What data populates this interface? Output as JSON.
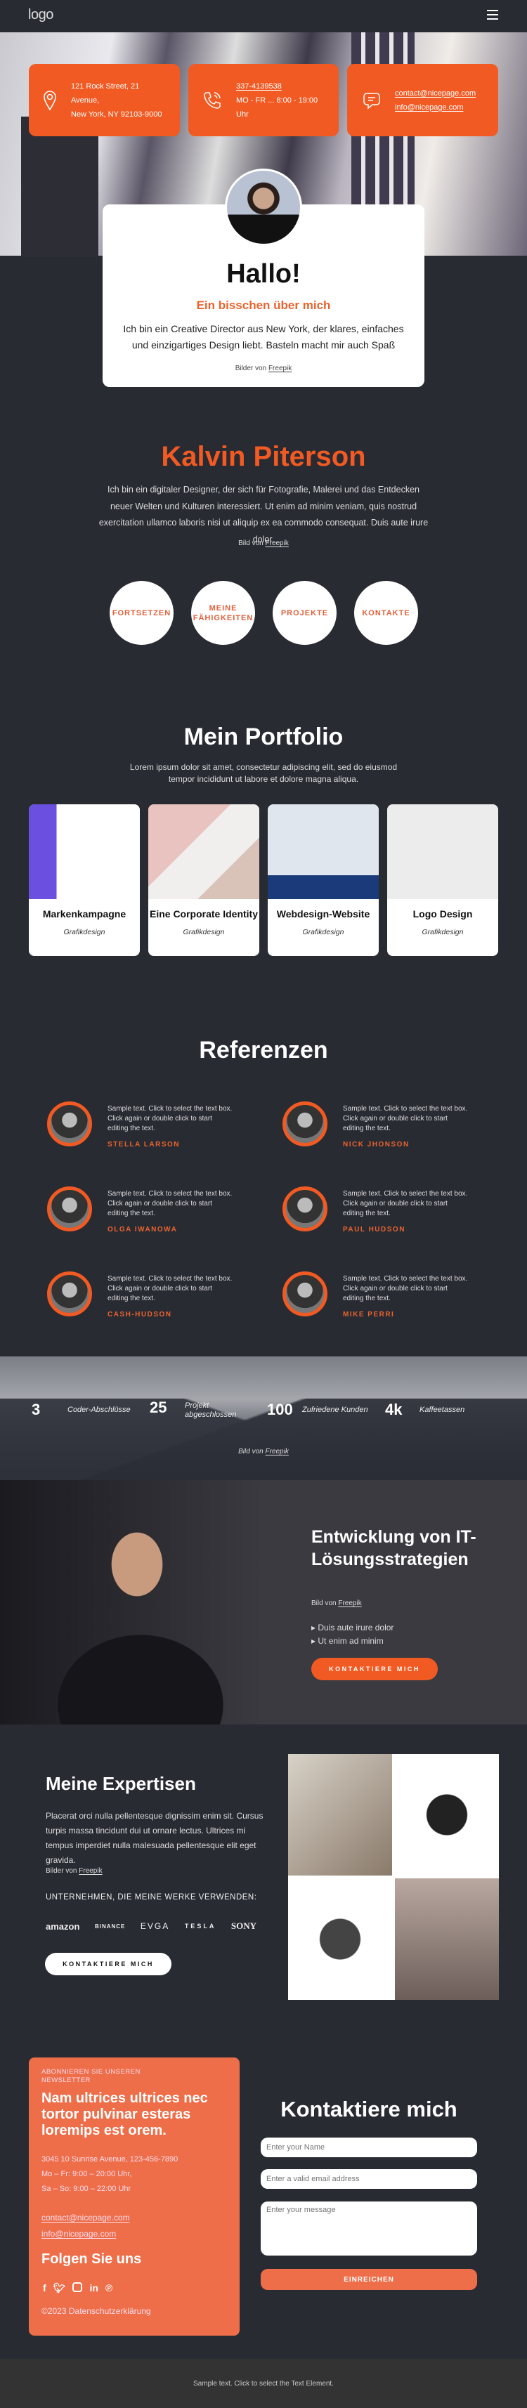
{
  "header": {
    "logo": "logo",
    "menu_icon": "hamburger-icon"
  },
  "colors": {
    "accent": "#f15a22",
    "newsletter": "#ee6e4a",
    "background": "#292b33",
    "footer": "#333333"
  },
  "info_cards": [
    {
      "icon": "map-pin-icon",
      "line1": "121 Rock Street, 21 Avenue,",
      "line2": "New York, NY 92103-9000"
    },
    {
      "icon": "phone-icon",
      "line1": "337-4139538",
      "line2": "MO - FR ... 8:00 - 19:00 Uhr"
    },
    {
      "icon": "chat-icon",
      "line1": "contact@nicepage.com",
      "line2": "info@nicepage.com"
    }
  ],
  "hello": {
    "title": "Hallo!",
    "subtitle": "Ein bisschen über mich",
    "text": "Ich bin ein Creative Director aus New York, der klares, einfaches und einzigartiges Design liebt. Basteln macht mir auch Spaß",
    "credit_prefix": "Bilder von",
    "credit_link": "Freepik"
  },
  "about": {
    "name": "Kalvin Piterson",
    "text": "Ich bin ein digitaler Designer, der sich für Fotografie, Malerei und das Entdecken neuer Welten und Kulturen interessiert. Ut enim ad minim veniam, quis nostrud exercitation ullamco laboris nisi ut aliquip ex ea commodo consequat. Duis aute irure dolor.",
    "credit_prefix": "Bild von",
    "credit_link": "Freepik",
    "buttons": [
      "FORTSETZEN",
      "MEINE FÄHIGKEITEN",
      "PROJEKTE",
      "KONTAKTE"
    ]
  },
  "portfolio": {
    "title": "Mein Portfolio",
    "text": "Lorem ipsum dolor sit amet, consectetur adipiscing elit, sed do eiusmod tempor incididunt ut labore et dolore magna aliqua.",
    "items": [
      {
        "title": "Markenkampagne",
        "category": "Grafikdesign"
      },
      {
        "title": "Eine Corporate Identity",
        "category": "Grafikdesign"
      },
      {
        "title": "Webdesign-Website",
        "category": "Grafikdesign"
      },
      {
        "title": "Logo Design",
        "category": "Grafikdesign"
      }
    ]
  },
  "references": {
    "title": "Referenzen",
    "text": "Sample text. Click to select the text box. Click again or double click to start editing the text.",
    "names": [
      "STELLA LARSON",
      "NICK JHONSON",
      "OLGA IWANOWA",
      "PAUL HUDSON",
      "CASH-HUDSON",
      "MIKE PERRI"
    ]
  },
  "stats": {
    "items": [
      {
        "num": "3",
        "label": "Coder-Abschlüsse"
      },
      {
        "num": "25",
        "label": "Projekt abgeschlossen"
      },
      {
        "num": "100",
        "label": "Zufriedene Kunden"
      },
      {
        "num": "4k",
        "label": "Kaffeetassen"
      }
    ],
    "credit_prefix": "Bild von",
    "credit_link": "Freepik"
  },
  "it": {
    "title": "Entwicklung von IT-Lösungsstrategien",
    "credit_prefix": "Bild von",
    "credit_link": "Freepik",
    "bullets": [
      "Duis aute irure dolor",
      "Ut enim ad minim"
    ],
    "button": "KONTAKTIERE MICH"
  },
  "expertise": {
    "title": "Meine Expertisen",
    "text": "Placerat orci nulla pellentesque dignissim enim sit. Cursus turpis massa tincidunt dui ut ornare lectus. Ultrices mi tempus imperdiet nulla malesuada pellentesque elit eget gravida.",
    "credit_prefix": "Bilder von",
    "credit_link": "Freepik",
    "companies_label": "UNTERNEHMEN, DIE MEINE WERKE VERWENDEN:",
    "logos": [
      "amazon",
      "BINANCE",
      "EVGA",
      "TESLA",
      "SONY"
    ],
    "button": "KONTAKTIERE MICH"
  },
  "newsletter": {
    "kicker": "ABONNIEREN SIE UNSEREN NEWSLETTER",
    "headline": "Nam ultrices ultrices nec tortor pulvinar esteras loremips est orem.",
    "address": "3045 10 Sunrise Avenue, 123-456-7890",
    "hours1": "Mo – Fr: 9:00 – 20:00 Uhr,",
    "hours2": "Sa – So: 9:00 – 22:00 Uhr",
    "email1": "contact@nicepage.com",
    "email2": "info@nicepage.com",
    "follow": "Folgen Sie uns",
    "social": [
      "facebook-icon",
      "twitter-icon",
      "instagram-icon",
      "linkedin-icon",
      "pinterest-icon"
    ],
    "copyright": "©2023 Datenschutzerklärung"
  },
  "contact": {
    "title": "Kontaktiere mich",
    "name_placeholder": "Enter your Name",
    "email_placeholder": "Enter a valid email address",
    "message_placeholder": "Enter your message",
    "submit": "EINREICHEN"
  },
  "footer": {
    "text": "Sample text. Click to select the Text Element."
  }
}
